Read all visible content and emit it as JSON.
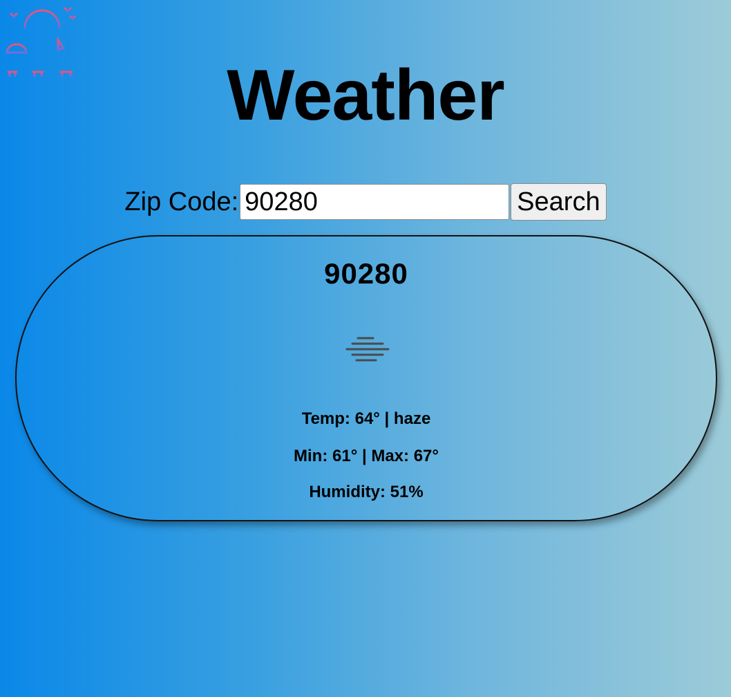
{
  "header": {
    "title": "Weather",
    "logo_icon": "sunset-beach-icon"
  },
  "search": {
    "label": "Zip Code:",
    "value": "90280",
    "button_label": "Search"
  },
  "result": {
    "zip": "90280",
    "icon": "haze-icon",
    "temp_line": "Temp: 64° | haze",
    "minmax_line": "Min: 61° | Max: 67°",
    "humidity_line": "Humidity: 51%"
  },
  "colors": {
    "gradient_start": "#0a88e8",
    "gradient_end": "#9ccbd8",
    "logo_top": "#e8547a",
    "logo_bottom": "#6f6fe0"
  }
}
